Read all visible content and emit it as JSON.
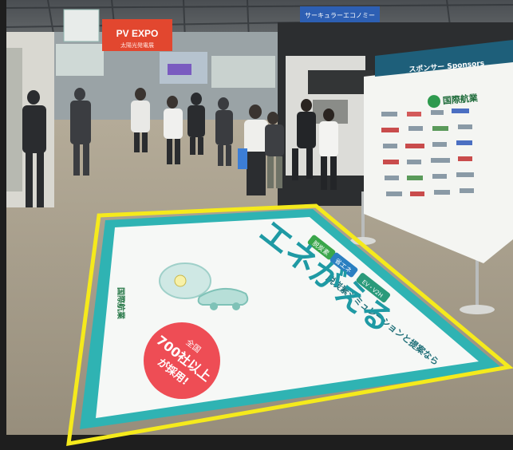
{
  "signs": {
    "pv_expo_title": "PV EXPO",
    "pv_expo_sub": "太陽光発電展",
    "hall_banner": "サーキュラーエコノミー",
    "sponsors_heading": "スポンサー Sponsors",
    "sponsor_logo_text": "国際航業"
  },
  "floor_mat": {
    "tag_1": "脱炭素",
    "tag_2": "省エネ",
    "tag_3": "EV・V2H",
    "subtitle": "脱炭素シミュレーションと提案なら",
    "title": "エネがえる",
    "badge_line1": "全国",
    "badge_line2": "700社以上",
    "badge_line3": "が採用!",
    "side_logo": "国際航業"
  },
  "colors": {
    "highlight_outline": "#f5ea1c",
    "mat_border": "#2fb3b3",
    "mat_face": "#f6f8f6",
    "badge_red": "#ee4d55",
    "title_teal": "#1f9aa4",
    "tag_green": "#3aa64a",
    "tag_blue": "#2a7fc1",
    "pv_sign_red": "#e2472f"
  }
}
